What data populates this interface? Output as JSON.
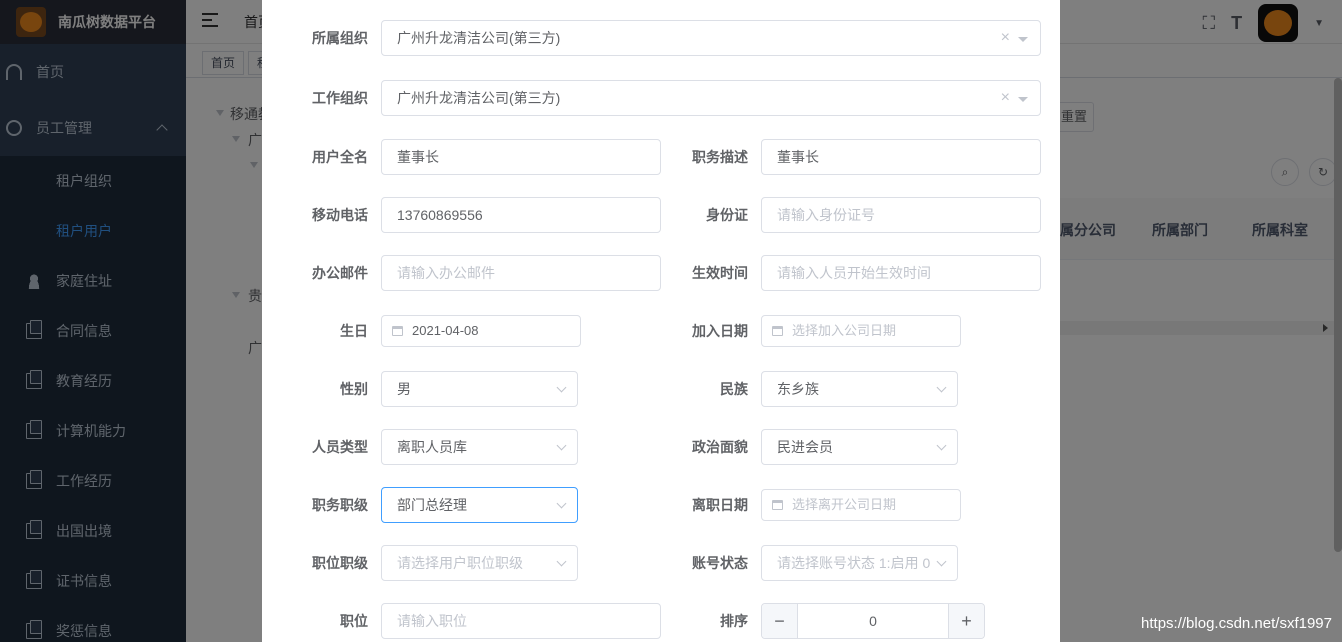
{
  "app": {
    "title": "南瓜树数据平台"
  },
  "sidebar": {
    "items": [
      {
        "label": "首页",
        "icon": "dashboard-icon"
      },
      {
        "label": "员工管理",
        "icon": "user-icon",
        "expanded": true
      },
      {
        "label": "租户组织",
        "icon": ""
      },
      {
        "label": "租户用户",
        "icon": "",
        "active": true
      },
      {
        "label": "家庭住址",
        "icon": "people-icon"
      },
      {
        "label": "合同信息",
        "icon": "document-icon"
      },
      {
        "label": "教育经历",
        "icon": "document-icon"
      },
      {
        "label": "计算机能力",
        "icon": "document-icon"
      },
      {
        "label": "工作经历",
        "icon": "document-icon"
      },
      {
        "label": "出国出境",
        "icon": "document-icon"
      },
      {
        "label": "证书信息",
        "icon": "document-icon"
      },
      {
        "label": "奖惩信息",
        "icon": "document-icon"
      }
    ]
  },
  "header": {
    "crumb": "首页",
    "fullscreen_icon": "fullscreen-icon",
    "font_size_icon": "font-size-icon"
  },
  "tags": [
    {
      "label": "首页"
    },
    {
      "label": "租"
    }
  ],
  "background": {
    "tree": [
      "移通教",
      "广",
      "贵",
      "广"
    ],
    "reset_label": "重置",
    "table_headers": [
      "属分公司",
      "所属部门",
      "所属科室"
    ]
  },
  "form": {
    "org_label": "所属组织",
    "org_value": "广州升龙清洁公司(第三方)",
    "work_org_label": "工作组织",
    "work_org_value": "广州升龙清洁公司(第三方)",
    "fullname_label": "用户全名",
    "fullname_value": "董事长",
    "job_desc_label": "职务描述",
    "job_desc_value": "董事长",
    "mobile_label": "移动电话",
    "mobile_value": "13760869556",
    "idcard_label": "身份证",
    "idcard_placeholder": "请输入身份证号",
    "email_label": "办公邮件",
    "email_placeholder": "请输入办公邮件",
    "effective_label": "生效时间",
    "effective_placeholder": "请输入人员开始生效时间",
    "birthday_label": "生日",
    "birthday_value": "2021-04-08",
    "join_label": "加入日期",
    "join_placeholder": "选择加入公司日期",
    "gender_label": "性别",
    "gender_value": "男",
    "nation_label": "民族",
    "nation_value": "东乡族",
    "ptype_label": "人员类型",
    "ptype_value": "离职人员库",
    "political_label": "政治面貌",
    "political_value": "民进会员",
    "duty_label": "职务职级",
    "duty_value": "部门总经理",
    "leave_label": "离职日期",
    "leave_placeholder": "选择离开公司日期",
    "post_level_label": "职位职级",
    "post_level_placeholder": "请选择用户职位职级",
    "account_label": "账号状态",
    "account_placeholder": "请选择账号状态 1:启用 0",
    "position_label": "职位",
    "position_placeholder": "请输入职位",
    "sort_label": "排序",
    "sort_value": "0"
  },
  "watermark": "https://blog.csdn.net/sxf1997"
}
